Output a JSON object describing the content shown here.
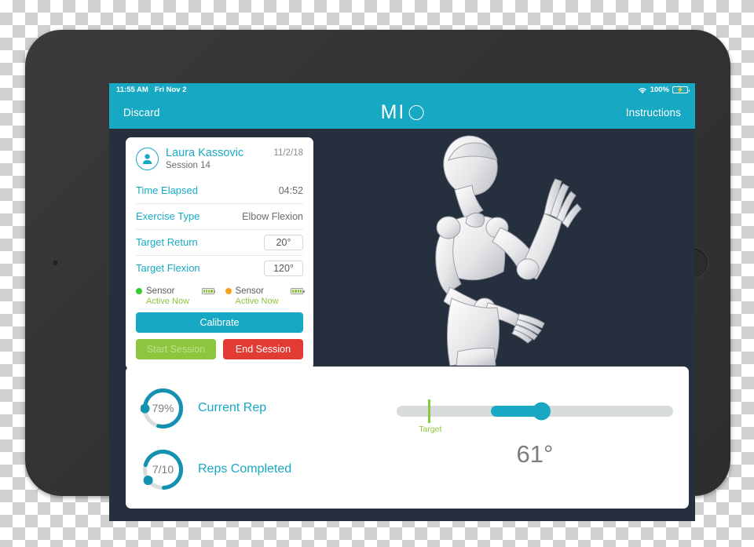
{
  "status_bar": {
    "time": "11:55 AM",
    "date": "Fri Nov 2",
    "wifi_icon": "wifi-icon",
    "battery_percent": "100%",
    "battery_icon": "battery-charging-icon"
  },
  "nav_bar": {
    "discard_label": "Discard",
    "app_title": "MIO",
    "instructions_label": "Instructions"
  },
  "info_card": {
    "avatar_icon": "person-avatar-icon",
    "patient_name": "Laura Kassovic",
    "session_label": "Session 14",
    "date": "11/2/18",
    "rows": [
      {
        "label": "Time Elapsed",
        "value": "04:52"
      },
      {
        "label": "Exercise Type",
        "value": "Elbow Flexion"
      },
      {
        "label": "Target Return",
        "value": "20°"
      },
      {
        "label": "Target Flexion",
        "value": "120°"
      }
    ],
    "sensors": [
      {
        "name": "Sensor",
        "status": "Active Now",
        "dot_color": "#2ecc2e",
        "battery_icon": "battery-icon"
      },
      {
        "name": "Sensor",
        "status": "Active Now",
        "dot_color": "#f5a31a",
        "battery_icon": "battery-icon"
      }
    ],
    "calibrate_label": "Calibrate",
    "start_session_label": "Start Session",
    "end_session_label": "End Session"
  },
  "progress": {
    "current_rep": {
      "value_text": "79%",
      "label": "Current Rep",
      "percent": 79
    },
    "reps_completed": {
      "value_text": "7/10",
      "label": "Reps Completed",
      "percent": 70
    }
  },
  "slider": {
    "target_label": "Target",
    "target_percent": 11.5,
    "value_percent": 52.5,
    "angle_readout": "61°"
  },
  "colors": {
    "accent_teal": "#17a9c4",
    "green": "#8cc63e",
    "red": "#e23b33",
    "orange": "#f5a31a",
    "screen_background": "#262f3d"
  }
}
